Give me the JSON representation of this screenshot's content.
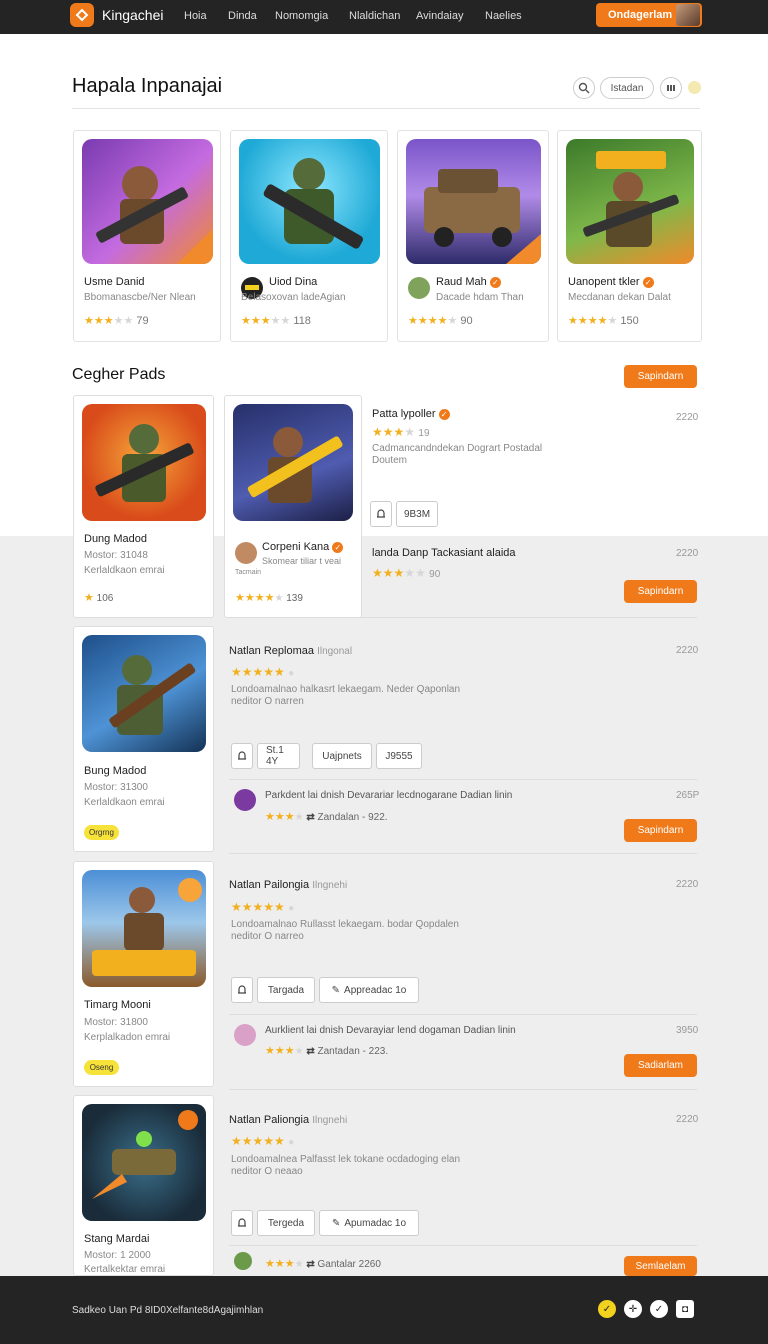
{
  "header": {
    "brand": "Kingachei",
    "nav": [
      "Hoia",
      "Dinda",
      "Nomomgia",
      "Nlaldichan",
      "Avindaiay",
      "Naelies"
    ],
    "cta": "Ondagerlam"
  },
  "page": {
    "title": "Hapala Inpanajai",
    "filter_pill": "Istadan"
  },
  "featured": [
    {
      "name": "Usme Danid",
      "sub": "Bbomanascbe/Ner Nlean",
      "stars": 3,
      "count": "79"
    },
    {
      "name": "Uiod Dina",
      "sub": "Belasoxovan ladeAgian",
      "stars": 3,
      "count": "118"
    },
    {
      "name": "Raud Mah",
      "sub": "Dacade hdam Than",
      "stars": 4,
      "count": "90"
    },
    {
      "name": "Uanopent tkler",
      "sub": "Mecdanan dekan Dalat",
      "stars": 4,
      "count": "150"
    }
  ],
  "section2": {
    "title": "Cegher Pads",
    "btn": "Sapindarn"
  },
  "cards": [
    {
      "title": "Dung Madod",
      "line1": "Mostor: 31048",
      "line2": "Kerlaldkaon emrai",
      "rating": "106"
    },
    {
      "title": "Corpeni Kana",
      "sub": "Skomear tiliar t veai",
      "line2": "Tacmain",
      "rating": "139"
    },
    {
      "title": "Bung Madod",
      "line1": "Mostor: 31300",
      "line2": "Kerlaldkaon emrai",
      "tag": "Orgrng"
    },
    {
      "title": "Timarg Mooni",
      "line1": "Mostor: 31800",
      "line2": "Kerplalkadon emrai",
      "tag": "Oseng"
    },
    {
      "title": "Stang Mardai",
      "line1": "Mostor: 1 2000",
      "line2": "Kertalkektar emrai"
    }
  ],
  "rows": [
    {
      "title": "Patta lypoller",
      "stars": 3,
      "count": "19",
      "num": "2220",
      "desc1": "Cadmancandndekan Dogrart Postadal",
      "desc2": "Doutem",
      "btn": "9B3M"
    },
    {
      "title": "landa Danp Tackasiant alaida",
      "stars": 3,
      "count": "90",
      "num": "2220",
      "btn": "Sapindarn"
    },
    {
      "title": "Natlan Replomaa",
      "tag": "Ilngonal",
      "num": "2220",
      "desc1": "Londoamalnao halkasrt lekaegam. Neder Qaponlan",
      "desc2": "neditor O narren",
      "b1": "St.1 4Y",
      "b2": "Uajpnets",
      "b3": "J9555"
    },
    {
      "title": "Parkdent lai dnish Devarariar lecdnogarane Dadian linin",
      "num": "265P",
      "meta": "Zandalan - 922.",
      "btn": "Sapindarn"
    },
    {
      "title": "Natlan Pailongia",
      "tag": "Ilngnehi",
      "num": "2220",
      "desc1": "Londoamalnao Rullasst lekaegam. bodar Qopdalen",
      "desc2": "neditor O narreo",
      "b1": "Targada",
      "b2": "Appreadac 1o"
    },
    {
      "title": "Aurklient lai dnish Devarayiar lend dogaman Dadian linin",
      "num": "3950",
      "meta": "Zantadan - 223.",
      "btn": "Sadiarlam"
    },
    {
      "title": "Natlan Paliongia",
      "tag": "Ilngnehi",
      "num": "2220",
      "desc1": "Londoamalnea Palfasst lek tokane ocdadoging elan",
      "desc2": "neditor O neaao",
      "b1": "Tergeda",
      "b2": "Apumadac 1o"
    },
    {
      "meta": "Gantalar",
      "num": "2260",
      "btn": "Semlaelam"
    }
  ],
  "footer": {
    "text": "Sadkeo Uan Pd 8ID0Xelfante8dAgajimhlan"
  }
}
